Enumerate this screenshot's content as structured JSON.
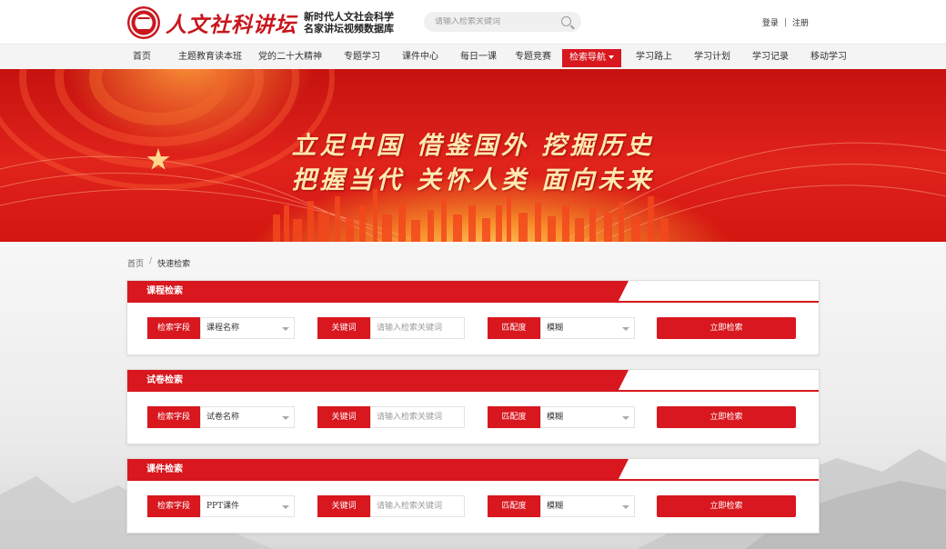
{
  "header": {
    "logo_text": "人文社科讲坛",
    "logo_sub_1": "新时代人文社会科学",
    "logo_sub_2": "名家讲坛视频数据库",
    "search_placeholder": "请输入检索关键词",
    "login": "登录",
    "separator": "|",
    "register": "注册"
  },
  "nav": {
    "items": [
      "首页",
      "主题教育读本班",
      "党的二十大精神",
      "专题学习",
      "课件中心",
      "每日一课",
      "专题竞赛",
      "检索导航",
      "学习路上",
      "学习计划",
      "学习记录",
      "移动学习"
    ],
    "active_index": 7
  },
  "banner": {
    "line1": "立足中国  借鉴国外  挖掘历史",
    "line2": "把握当代  关怀人类  面向未来"
  },
  "breadcrumb": {
    "home": "首页",
    "separator": "/",
    "current": "快速检索"
  },
  "panels": [
    {
      "title": "课程检索",
      "field_label": "检索字段",
      "field_value": "课程名称",
      "keyword_label": "关键词",
      "keyword_placeholder": "请输入检索关键词",
      "match_label": "匹配度",
      "match_value": "模糊",
      "button": "立即检索"
    },
    {
      "title": "试卷检索",
      "field_label": "检索字段",
      "field_value": "试卷名称",
      "keyword_label": "关键词",
      "keyword_placeholder": "请输入检索关键词",
      "match_label": "匹配度",
      "match_value": "模糊",
      "button": "立即检索"
    },
    {
      "title": "课件检索",
      "field_label": "检索字段",
      "field_value": "PPT课件",
      "keyword_label": "关键词",
      "keyword_placeholder": "请输入检索关键词",
      "match_label": "匹配度",
      "match_value": "模糊",
      "button": "立即检索"
    }
  ],
  "colors": {
    "brand_red": "#d8171e",
    "banner_gold": "#ffe9b0"
  },
  "icons": {
    "search": "search-icon",
    "dropdown": "chevron-down-icon",
    "emblem": "logo-emblem-icon"
  }
}
